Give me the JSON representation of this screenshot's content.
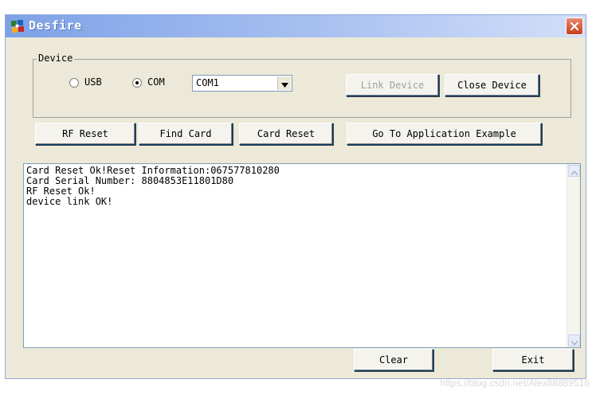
{
  "window": {
    "title": "Desfire",
    "icon": "puzzle-app-icon"
  },
  "device": {
    "legend": "Device",
    "radio_usb_label": "USB",
    "radio_com_label": "COM",
    "selected_mode": "COM",
    "port_value": "COM1",
    "link_device_label": "Link Device",
    "link_device_enabled": false,
    "close_device_label": "Close Device"
  },
  "actions": {
    "rf_reset_label": "RF Reset",
    "find_card_label": "Find Card",
    "card_reset_label": "Card Reset",
    "go_to_app_label": "Go To Application Example"
  },
  "log": {
    "lines": [
      "Card Reset Ok!Reset Information:067577810280",
      "Card Serial Number: 8804853E11801D80",
      "RF Reset Ok!",
      "device link OK!"
    ]
  },
  "footer": {
    "clear_label": "Clear",
    "exit_label": "Exit"
  },
  "watermark": "https://blog.csdn.net/Alex88889516",
  "colors": {
    "titlebar_start": "#7ea1e6",
    "titlebar_end": "#d3dff8",
    "close_button": "#c63f1e",
    "window_bg": "#ece9d8"
  }
}
